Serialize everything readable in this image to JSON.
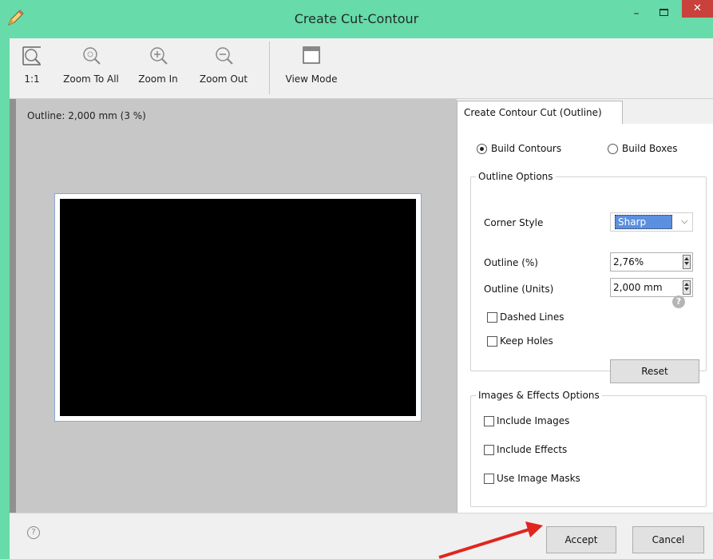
{
  "window": {
    "title": "Create Cut-Contour",
    "controls": {
      "minimize": "–",
      "close": "✕"
    }
  },
  "toolbar": {
    "items": [
      {
        "label": "1:1",
        "icon": "actual-size-icon"
      },
      {
        "label": "Zoom To All",
        "icon": "zoom-to-all-icon"
      },
      {
        "label": "Zoom In",
        "icon": "zoom-in-icon"
      },
      {
        "label": "Zoom Out",
        "icon": "zoom-out-icon"
      },
      {
        "label": "View Mode",
        "icon": "view-mode-icon"
      }
    ]
  },
  "preview": {
    "status": "Outline: 2,000 mm (3 %)",
    "canvas_fill": "#000000"
  },
  "panel": {
    "tab_label": "Create Contour Cut (Outline)",
    "build_mode": {
      "options": [
        "Build Contours",
        "Build Boxes"
      ],
      "selected": "Build Contours"
    },
    "outline_options": {
      "title": "Outline Options",
      "corner_style_label": "Corner Style",
      "corner_style_value": "Sharp",
      "outline_pct_label": "Outline (%)",
      "outline_pct_value": "2,76%",
      "outline_units_label": "Outline (Units)",
      "outline_units_value": "2,000 mm",
      "dashed_lines_label": "Dashed Lines",
      "keep_holes_label": "Keep Holes",
      "help_glyph": "?",
      "reset_label": "Reset"
    },
    "images_effects": {
      "title": "Images & Effects Options",
      "include_images_label": "Include Images",
      "include_effects_label": "Include Effects",
      "use_image_masks_label": "Use Image Masks"
    }
  },
  "footer": {
    "help_glyph": "?",
    "accept_label": "Accept",
    "cancel_label": "Cancel"
  },
  "colors": {
    "titlebar": "#67dbaa",
    "close_button": "#c9413c",
    "selection": "#5b8fe0",
    "arrow": "#e0261e"
  }
}
